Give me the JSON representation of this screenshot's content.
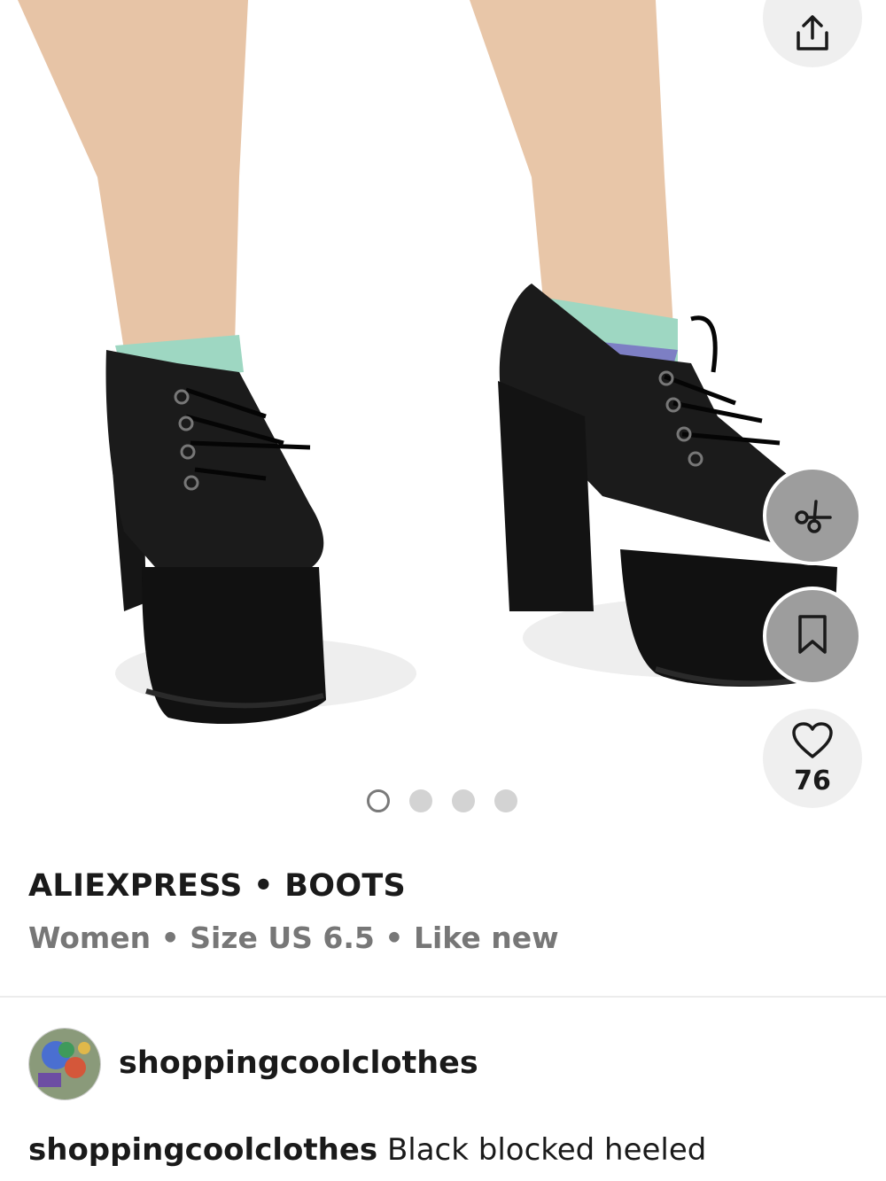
{
  "listing": {
    "brand_category": "ALIEXPRESS • BOOTS",
    "meta": "Women • Size US 6.5 • Like new",
    "likes": "76",
    "image_count": 4,
    "active_image": 1
  },
  "seller": {
    "username": "shoppingcoolclothes"
  },
  "description": {
    "author": "shoppingcoolclothes",
    "text": "Black blocked heeled"
  },
  "icons": {
    "share": "share-icon",
    "offer": "offer-icon",
    "save": "bookmark-icon",
    "like": "heart-icon"
  },
  "colors": {
    "text_primary": "#1a1a1a",
    "text_secondary": "#777777",
    "button_light": "#efefef",
    "button_grey": "#9d9d9d"
  }
}
